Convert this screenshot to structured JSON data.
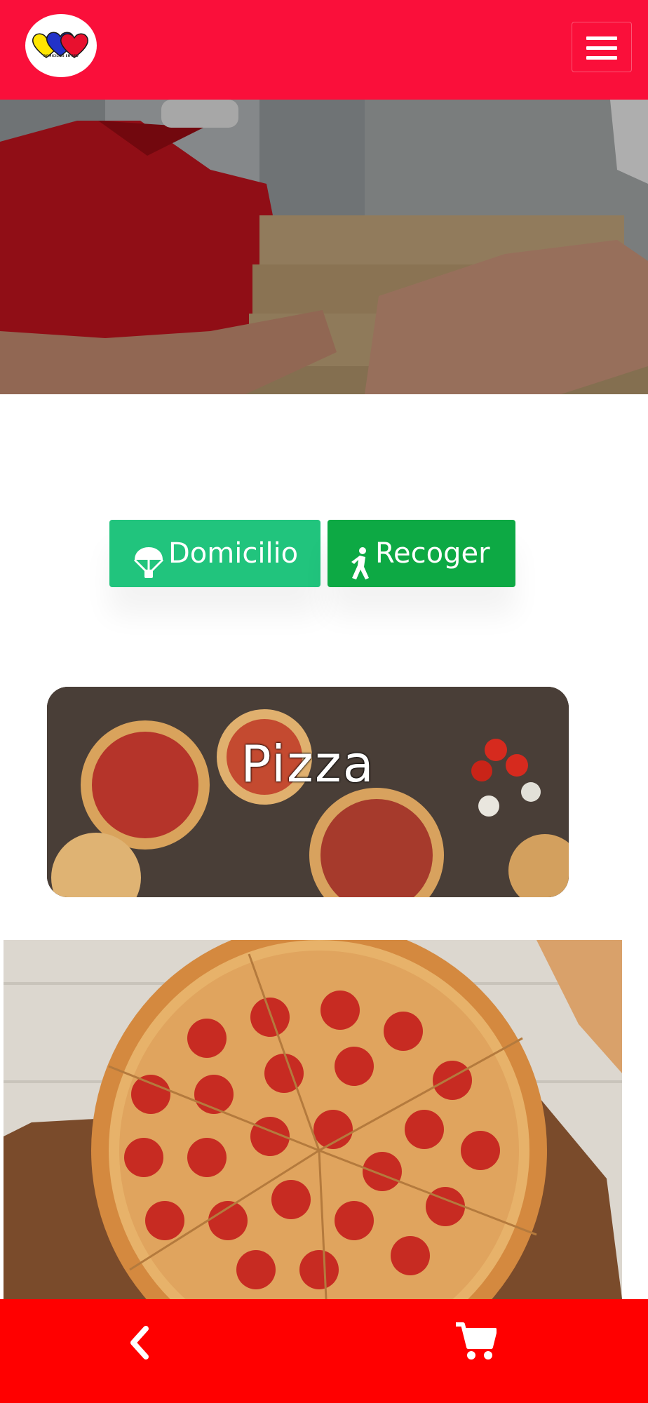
{
  "header": {
    "logo_caption": "DOMICILIOS EN RED",
    "menu_icon": "hamburger-menu-icon"
  },
  "hero": {
    "image": "delivery-person-holding-pizza-boxes"
  },
  "order_type": {
    "domicilio_label": "Domicilio",
    "domicilio_icon": "parachute-icon",
    "recoger_label": "Recoger",
    "recoger_icon": "walking-person-icon"
  },
  "category": {
    "title": "Pizza",
    "image": "pizzas-on-wooden-table"
  },
  "product": {
    "image": "pepperoni-pizza"
  },
  "footer": {
    "back_icon": "chevron-left-icon",
    "cart_icon": "shopping-cart-icon"
  },
  "colors": {
    "header_bg": "#fa0f3a",
    "footer_bg": "#ff0000",
    "domicilio_bg": "#21c47d",
    "recoger_bg": "#0da944"
  }
}
